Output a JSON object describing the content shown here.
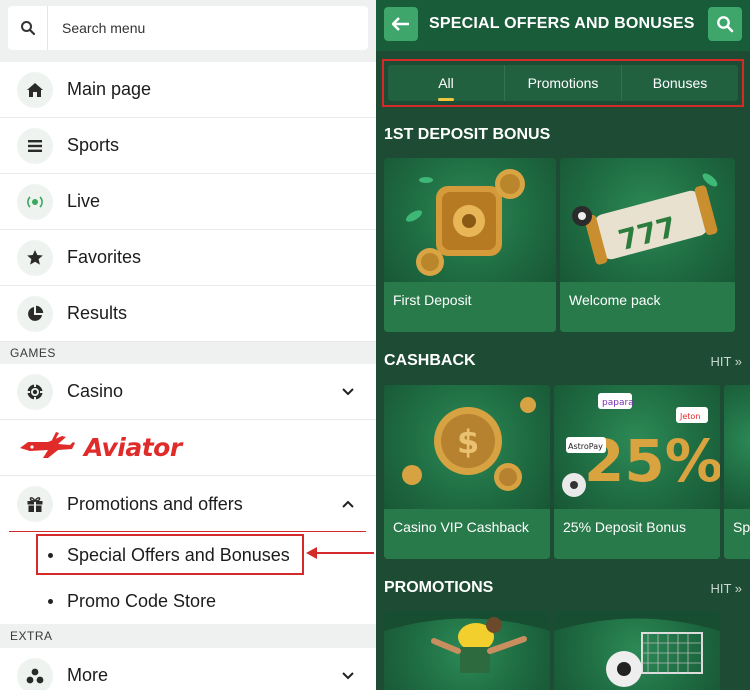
{
  "search": {
    "placeholder": "Search menu"
  },
  "menu": {
    "main_items": [
      {
        "label": "Main page",
        "icon": "home-icon"
      },
      {
        "label": "Sports",
        "icon": "list-icon"
      },
      {
        "label": "Live",
        "icon": "live-icon"
      },
      {
        "label": "Favorites",
        "icon": "star-icon"
      },
      {
        "label": "Results",
        "icon": "pie-chart-icon"
      }
    ],
    "games_header": "GAMES",
    "casino_label": "Casino",
    "aviator_label": "Aviator",
    "promotions_label": "Promotions and offers",
    "sub_items": [
      "Special Offers and Bonuses",
      "Promo Code Store"
    ],
    "extra_header": "EXTRA",
    "more_label": "More"
  },
  "offers": {
    "title": "SPECIAL OFFERS AND BONUSES",
    "tabs": [
      "All",
      "Promotions",
      "Bonuses"
    ],
    "active_tab": "All",
    "sections": [
      {
        "title": "1ST DEPOSIT BONUS",
        "cards": [
          "First Deposit",
          "Welcome pack"
        ]
      },
      {
        "title": "CASHBACK",
        "hit": "HIT »",
        "cards": [
          "Casino VIP Cashback",
          "25% Deposit Bonus",
          "Sp"
        ]
      },
      {
        "title": "PROMOTIONS",
        "hit": "HIT »"
      }
    ],
    "card_text": {
      "papara": "papara",
      "astropay": "AstroPay",
      "jeton": "Jeton",
      "pct": "25%"
    }
  },
  "colors": {
    "accent_red": "#d42a2a",
    "panel_green": "#1d4b33",
    "button_green": "#3ea66a",
    "tab_indicator": "#f2c53d"
  }
}
